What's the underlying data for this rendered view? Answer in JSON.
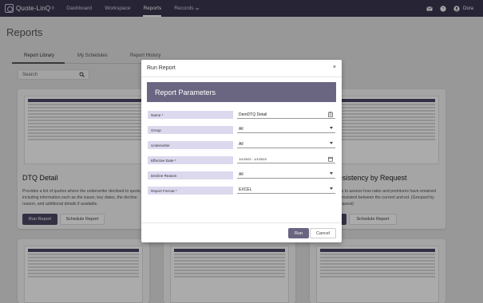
{
  "nav": {
    "logo": "Quote-LinQ",
    "logo_mark": "®",
    "items": [
      "Dashboard",
      "Workspace",
      "Reports",
      "Records"
    ],
    "user": "Dora"
  },
  "page": {
    "title": "Reports"
  },
  "tabs": [
    "Report Library",
    "My Schedules",
    "Report History"
  ],
  "search": {
    "placeholder": "Search"
  },
  "cards": [
    {
      "title": "DTQ Detail",
      "desc": "Provides a list of quotes where the underwriter declined to quote, including information such as the issuer, key dates, the decline reason, and additional details if available.",
      "run": "Run Report",
      "schedule": "Schedule Report"
    },
    {
      "title": "esistency by Request",
      "desc": "yis to assess how rates and premiums have emained consistent between the current and ed. (Grouped by request)",
      "run": "Run Report",
      "schedule": "Schedule Report"
    }
  ],
  "modal": {
    "title": "Run Report",
    "close": "×",
    "banner": "Report Parameters",
    "params": [
      {
        "label": "Name *",
        "value": "DemDTQ Detail"
      },
      {
        "label": "Group",
        "value": "All"
      },
      {
        "label": "Underwriter",
        "value": "All"
      },
      {
        "label": "Effective Date *",
        "value": "1/1/2022 - 1/1/2023"
      },
      {
        "label": "Decline Reason",
        "value": "All"
      },
      {
        "label": "Report Format *",
        "value": "EXCEL"
      }
    ],
    "run": "Run",
    "cancel": "Cancel"
  },
  "colors": {
    "nav_bg": "#3b3650",
    "accent": "#6a6581",
    "label_bg": "#dcd8ee"
  },
  "icons": [
    "mail-icon",
    "help-icon",
    "user-icon",
    "search-icon",
    "chevron-down-icon",
    "clipboard-icon",
    "calendar-icon"
  ]
}
